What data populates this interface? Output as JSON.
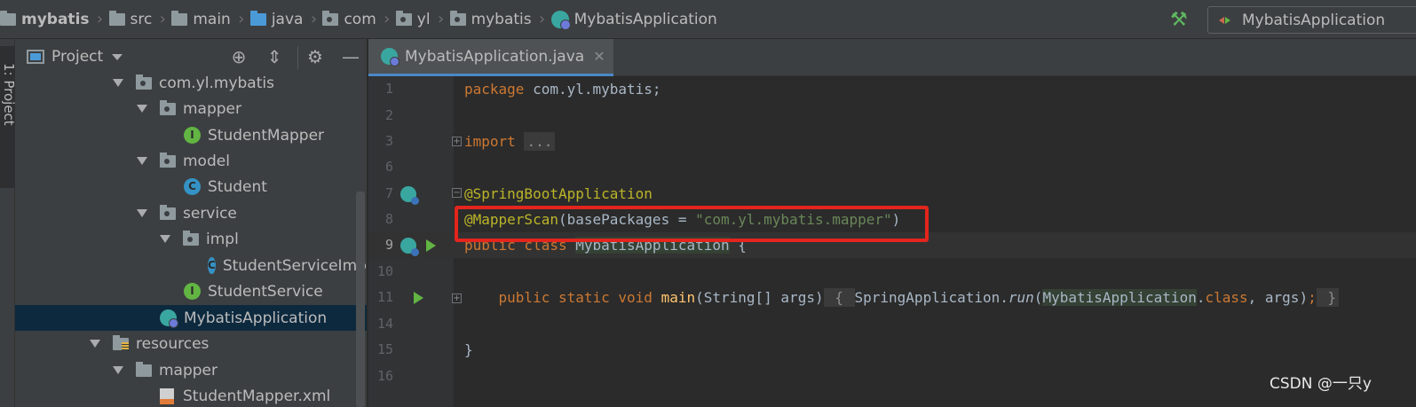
{
  "breadcrumb": [
    {
      "label": "mybatis",
      "icon": "folder-icon"
    },
    {
      "label": "src",
      "icon": "folder-icon"
    },
    {
      "label": "main",
      "icon": "folder-icon"
    },
    {
      "label": "java",
      "icon": "source-folder-icon"
    },
    {
      "label": "com",
      "icon": "package-icon"
    },
    {
      "label": "yl",
      "icon": "package-icon"
    },
    {
      "label": "mybatis",
      "icon": "package-icon"
    },
    {
      "label": "MybatisApplication",
      "icon": "spring-boot-class-icon"
    }
  ],
  "toolbar": {
    "run_config": "MybatisApplication"
  },
  "tool_window_stripe": {
    "label": "1: Project"
  },
  "project_panel": {
    "title": "Project",
    "tree": [
      {
        "label": "com.yl.mybatis",
        "type": "package",
        "expanded": true
      },
      {
        "label": "mapper",
        "type": "package",
        "expanded": true
      },
      {
        "label": "StudentMapper",
        "type": "interface",
        "badge": "I"
      },
      {
        "label": "model",
        "type": "package",
        "expanded": true
      },
      {
        "label": "Student",
        "type": "class",
        "badge": "C"
      },
      {
        "label": "service",
        "type": "package",
        "expanded": true
      },
      {
        "label": "impl",
        "type": "package",
        "expanded": true
      },
      {
        "label": "StudentServiceImpl",
        "type": "class",
        "badge": "C"
      },
      {
        "label": "StudentService",
        "type": "interface",
        "badge": "I"
      },
      {
        "label": "MybatisApplication",
        "type": "spring-boot-class",
        "selected": true
      },
      {
        "label": "resources",
        "type": "resources-folder",
        "expanded": true
      },
      {
        "label": "mapper",
        "type": "folder",
        "expanded": true
      },
      {
        "label": "StudentMapper.xml",
        "type": "xml-file"
      }
    ]
  },
  "editor": {
    "tab": "MybatisApplication.java",
    "current_line": "9",
    "lines": [
      {
        "num": "1",
        "text": "package com.yl.mybatis;"
      },
      {
        "num": "2",
        "text": ""
      },
      {
        "num": "3",
        "text": "import ..."
      },
      {
        "num": "6",
        "text": ""
      },
      {
        "num": "7",
        "text": "@SpringBootApplication"
      },
      {
        "num": "8",
        "text": "@MapperScan(basePackages = \"com.yl.mybatis.mapper\")"
      },
      {
        "num": "9",
        "text": "public class MybatisApplication {"
      },
      {
        "num": "10",
        "text": ""
      },
      {
        "num": "11",
        "text": "    public static void main(String[] args) { SpringApplication.run(MybatisApplication.class, args); }"
      },
      {
        "num": "14",
        "text": ""
      },
      {
        "num": "15",
        "text": "}"
      },
      {
        "num": "16",
        "text": ""
      }
    ],
    "code_tokens": {
      "l1_kw": "package",
      "l1_rest": " com.yl.mybatis;",
      "l3_kw": "import",
      "l3_fold": "...",
      "l7_ann": "@SpringBootApplication",
      "l8_ann": "@MapperScan",
      "l8_open": "(basePackages = ",
      "l8_str": "\"com.yl.mybatis.mapper\"",
      "l8_close": ")",
      "l9_kw": "public class ",
      "l9_cls": "MybatisApplication",
      "l9_rest": " {",
      "l11_indent": "    ",
      "l11_kw": "public static void ",
      "l11_fn": "main",
      "l11_args": "(String[] args)",
      "l11_brace_open": " { ",
      "l11_call": "SpringApplication.",
      "l11_run": "run",
      "l11_p": "(",
      "l11_cls": "MybatisApplication",
      "l11_dot": ".",
      "l11_kw2": "class",
      "l11_comma": ", args)",
      "l11_semi": ";",
      "l11_brace_close": " }",
      "l15": "}"
    },
    "highlight_color": "#e3251d"
  },
  "watermark": "CSDN @一只y"
}
